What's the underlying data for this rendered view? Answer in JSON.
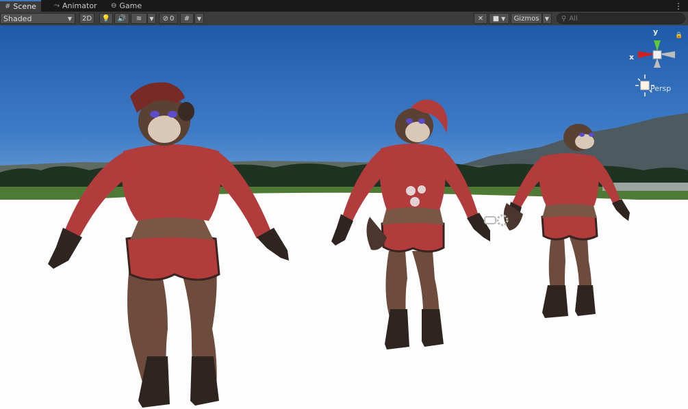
{
  "tabs": [
    {
      "label": "Scene",
      "icon": "grid-icon",
      "active": true
    },
    {
      "label": "Animator",
      "icon": "animator-icon",
      "active": false
    },
    {
      "label": "Game",
      "icon": "gamepad-icon",
      "active": false
    }
  ],
  "toolbar": {
    "shading_mode": "Shaded",
    "mode_2d": "2D",
    "hidden_count": "0",
    "gizmos_label": "Gizmos",
    "search_placeholder": "All"
  },
  "gizmo": {
    "x_label": "x",
    "y_label": "y",
    "persp_label": "Persp"
  },
  "colors": {
    "accent": "#3a79bb",
    "axis_x": "#d01f1f",
    "axis_y": "#5ec83a",
    "outfit": "#b23b3b",
    "fur": "#6a4a3a"
  }
}
